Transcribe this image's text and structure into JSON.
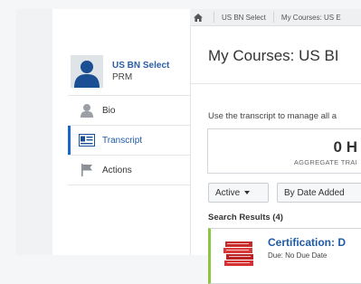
{
  "breadcrumb": {
    "items": [
      "US BN Select",
      "My Courses: US E"
    ]
  },
  "profile": {
    "name": "US BN Select",
    "role": "PRM"
  },
  "sidebar": {
    "items": [
      {
        "label": "Bio",
        "icon": "person-icon"
      },
      {
        "label": "Transcript",
        "icon": "transcript-icon",
        "active": true
      },
      {
        "label": "Actions",
        "icon": "flag-icon"
      }
    ]
  },
  "main": {
    "title": "My Courses: US BI",
    "description": "Use the transcript to manage all a",
    "stat": {
      "value": "0 H",
      "label": "AGGREGATE TRAI"
    },
    "filters": {
      "status": "Active",
      "sort": "By Date Added"
    },
    "results_label": "Search Results (4)",
    "course": {
      "title": "Certification: D",
      "due": "Due: No Due Date"
    }
  },
  "colors": {
    "accent": "#1a66cc",
    "link": "#1f5aa6",
    "card_border": "#8cc63f"
  }
}
